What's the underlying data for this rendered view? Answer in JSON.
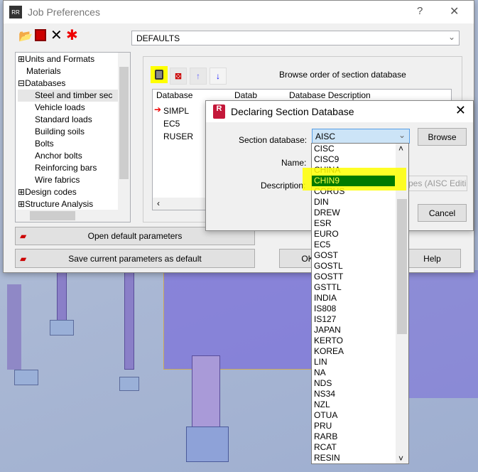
{
  "job_prefs": {
    "title": "Job Preferences",
    "help_btn": "?",
    "close_btn": "✕",
    "preset": "DEFAULTS",
    "tree": [
      "Units and Formats",
      "Materials",
      "Databases",
      "Steel and timber sec",
      "Vehicle loads",
      "Standard loads",
      "Building soils",
      "Bolts",
      "Anchor bolts",
      "Reinforcing bars",
      "Wire fabrics",
      "Design codes",
      "Structure Analysis"
    ],
    "browse_order_label": "Browse order of section database",
    "table": {
      "headers": [
        "Database",
        "Datab",
        "Database Description"
      ],
      "rows": [
        "SIMPL",
        "EC5",
        "RUSER"
      ]
    },
    "open_default": "Open default parameters",
    "save_default": "Save current parameters as default",
    "ok": "OK",
    "help": "Help"
  },
  "dialog": {
    "title": "Declaring Section Database",
    "section_label": "Section database:",
    "section_value": "AISC",
    "browse": "Browse",
    "name_label": "Name:",
    "description_label": "Description:",
    "description_value": "pes (AISC Editi",
    "cancel": "Cancel",
    "options": [
      "CISC",
      "CISC9",
      "CHINA",
      "CHIN9",
      "CORUS",
      "DIN",
      "DREW",
      "ESR",
      "EURO",
      "EC5",
      "GOST",
      "GOSTL",
      "GOSTT",
      "GSTTL",
      "INDIA",
      "IS808",
      "IS127",
      "JAPAN",
      "KERTO",
      "KOREA",
      "LIN",
      "NA",
      "NDS",
      "NS34",
      "NZL",
      "OTUA",
      "PRU",
      "RARB",
      "RCAT",
      "RESIN"
    ],
    "selected": "CHIN9"
  },
  "colors": {
    "highlight": "#ffff00",
    "selection": "#007a00",
    "accent": "#cc0000"
  }
}
